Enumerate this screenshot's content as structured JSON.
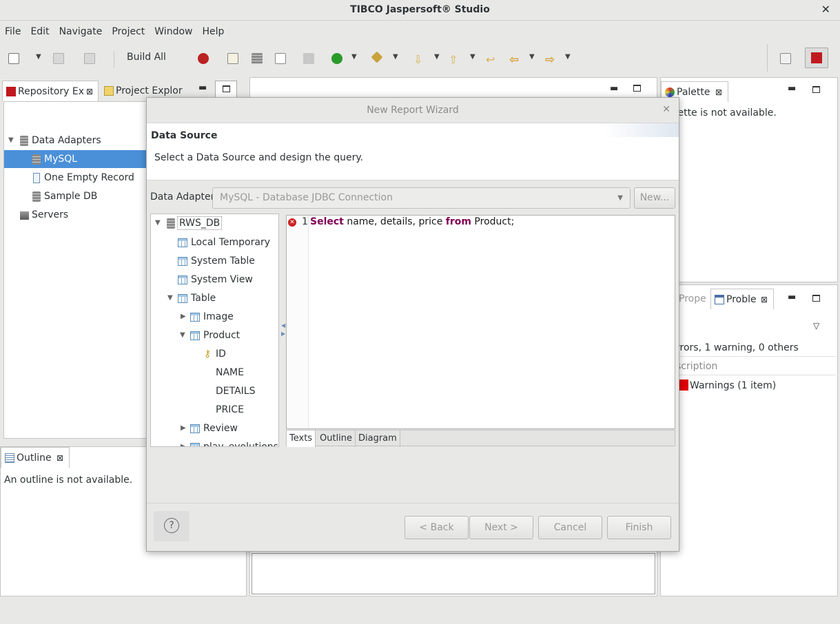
{
  "window": {
    "title": "TIBCO Jaspersoft® Studio",
    "close": "✕"
  },
  "menu": [
    "File",
    "Edit",
    "Navigate",
    "Project",
    "Window",
    "Help"
  ],
  "toolbar": {
    "build_all": "Build All"
  },
  "left_panel": {
    "tabs": [
      "Repository Ex",
      "Project Explor"
    ],
    "tree": {
      "data_adapters": "Data Adapters",
      "items": [
        "MySQL",
        "One Empty Record",
        "Sample DB"
      ],
      "servers": "Servers"
    }
  },
  "outline": {
    "tab": "Outline",
    "message": "An outline is not available."
  },
  "palette": {
    "tab": "Palette",
    "message": "alette is not available."
  },
  "problems": {
    "tabs": [
      "Prope",
      "Proble"
    ],
    "summary": "rrors, 1 warning, 0 others",
    "column": "scription",
    "row": "Warnings (1 item)"
  },
  "dialog": {
    "title": "New Report Wizard",
    "heading": "Data Source",
    "description": "Select a Data Source and design the query.",
    "adapter_label": "Data Adapter",
    "adapter_value": "MySQL - Database JDBC Connection",
    "new_button": "New...",
    "db_tree": {
      "root": "RWS_DB",
      "nodes": [
        "Local Temporary",
        "System Table",
        "System View",
        "Table"
      ],
      "tables": [
        "Image",
        "Product"
      ],
      "columns": [
        "ID",
        "NAME",
        "DETAILS",
        "PRICE"
      ],
      "more": [
        "Review",
        "play_evolutions"
      ]
    },
    "editor": {
      "line_number": "1",
      "kw1": "Select",
      "mid": " name, details, price ",
      "kw2": "from",
      "tail": " Product;"
    },
    "editor_tabs": [
      "Texts",
      "Outline",
      "Diagram"
    ],
    "buttons": {
      "help": "?",
      "back": "< Back",
      "next": "Next >",
      "cancel": "Cancel",
      "finish": "Finish"
    }
  },
  "colors": {
    "selection": "#4a90d9",
    "keyword": "#7f0055",
    "error": "#cc0000",
    "warning_marker": "#e00000"
  }
}
